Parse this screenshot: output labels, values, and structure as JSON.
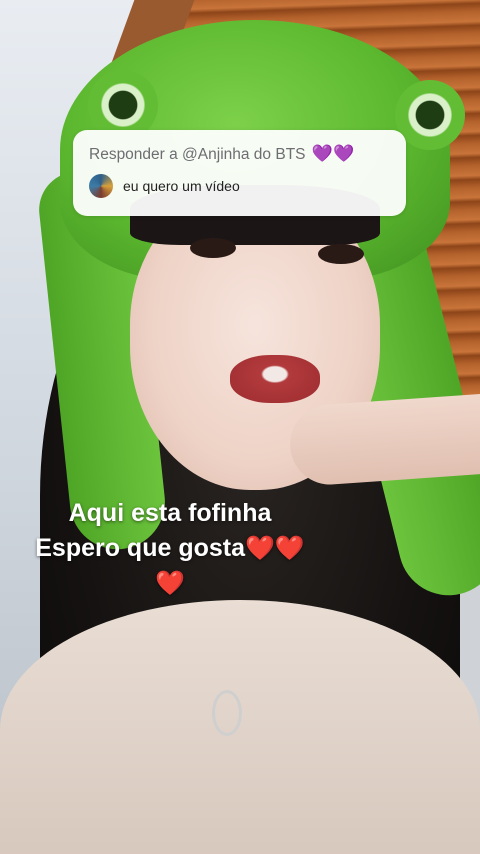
{
  "reply": {
    "prefix": "Responder a @Anjinha do BTS",
    "emojis": "💜💜",
    "comment": "eu quero um vídeo"
  },
  "caption": {
    "line1": "Aqui esta fofinha",
    "line2": "Espero que gosta",
    "hearts": "❤️❤️",
    "line3_heart": "❤️"
  },
  "colors": {
    "caption_text": "#ffffff",
    "heart": "#e0112b",
    "reply_title": "#6d6d72",
    "reply_card": "#ffffff"
  }
}
